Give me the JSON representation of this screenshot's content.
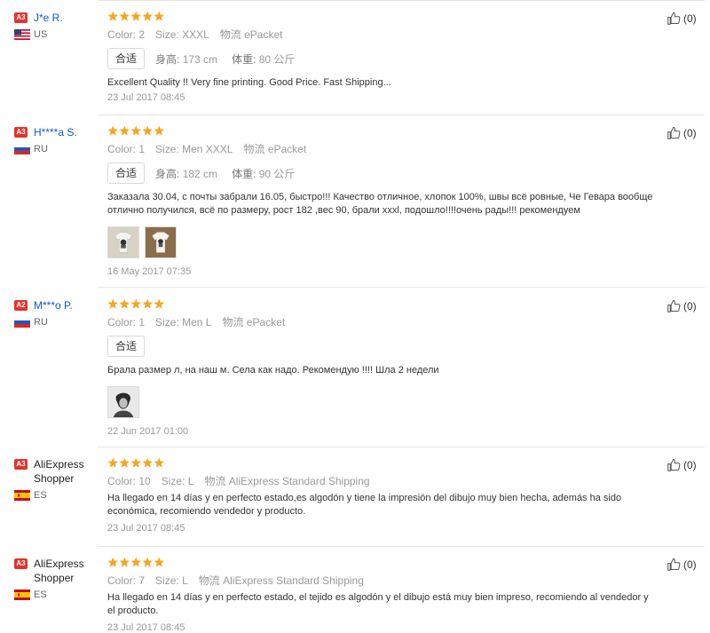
{
  "reviews": [
    {
      "level": "A3",
      "user": "J*e R.",
      "user_style": "link",
      "country": "US",
      "color_label": "Color:",
      "color": "2",
      "size_label": "Size:",
      "size": "XXXL",
      "ship_label": "物流",
      "ship": "ePacket",
      "fit": "合适",
      "height_label": "身高:",
      "height": "173 cm",
      "weight_label": "体重:",
      "weight": "80 公斤",
      "text": "Excellent Quality !! Very fine printing. Good Price. Fast Shipping...",
      "date": "23 Jul 2017 08:45",
      "likes": "(0)"
    },
    {
      "level": "A3",
      "user": "H****a S.",
      "user_style": "link",
      "country": "RU",
      "color_label": "Color:",
      "color": "1",
      "size_label": "Size:",
      "size": "Men XXXL",
      "ship_label": "物流",
      "ship": "ePacket",
      "fit": "合适",
      "height_label": "身高:",
      "height": "182 cm",
      "weight_label": "体重:",
      "weight": "90 公斤",
      "text": "Заказала 30.04, с почты забрали 16.05, быстро!!! Качество отличное, хлопок 100%, швы всё ровные, Че Гевара вообще отлично получился, всё по размеру, рост 182 ,вес 90, брали xxxl, подошло!!!!очень рады!!! рекомендуем",
      "date": "16 May 2017 07:35",
      "likes": "(0)"
    },
    {
      "level": "A2",
      "user": "M***o P.",
      "user_style": "link",
      "country": "RU",
      "color_label": "Color:",
      "color": "1",
      "size_label": "Size:",
      "size": "Men L",
      "ship_label": "物流",
      "ship": "ePacket",
      "fit": "合适",
      "text": "Брала размер л, на наш м. Села как надо. Рекомендую !!!! Шла 2 недели",
      "date": "22 Jun 2017 01:00",
      "likes": "(0)"
    },
    {
      "level": "A3",
      "user": "AliExpress Shopper",
      "user_style": "plain",
      "country": "ES",
      "color_label": "Color:",
      "color": "10",
      "size_label": "Size:",
      "size": "L",
      "ship_label": "物流",
      "ship": "AliExpress Standard Shipping",
      "text": "Ha llegado en 14 días y en perfecto estado,es algodón y tiene la impresión del dibujo muy bien hecha, además ha sido económica, recomiendo vendedor y producto.",
      "date": "23 Jul 2017 08:45",
      "likes": "(0)"
    },
    {
      "level": "A3",
      "user": "AliExpress Shopper",
      "user_style": "plain",
      "country": "ES",
      "color_label": "Color:",
      "color": "7",
      "size_label": "Size:",
      "size": "L",
      "ship_label": "物流",
      "ship": "AliExpress Standard Shipping",
      "text": "Ha llegado en 14 días y en perfecto estado, el tejido es algodón y el dibujo está muy bien impreso, recomiendo al vendedor y el producto.",
      "date": "23 Jul 2017 08:45",
      "likes": "(0)"
    }
  ],
  "rating_stars": 5,
  "colors": {
    "star": "#f5a623",
    "badge": "#e0352b",
    "link": "#0b5ad3"
  },
  "icons": {
    "like": "thumbs-up-icon",
    "star": "star-icon"
  }
}
